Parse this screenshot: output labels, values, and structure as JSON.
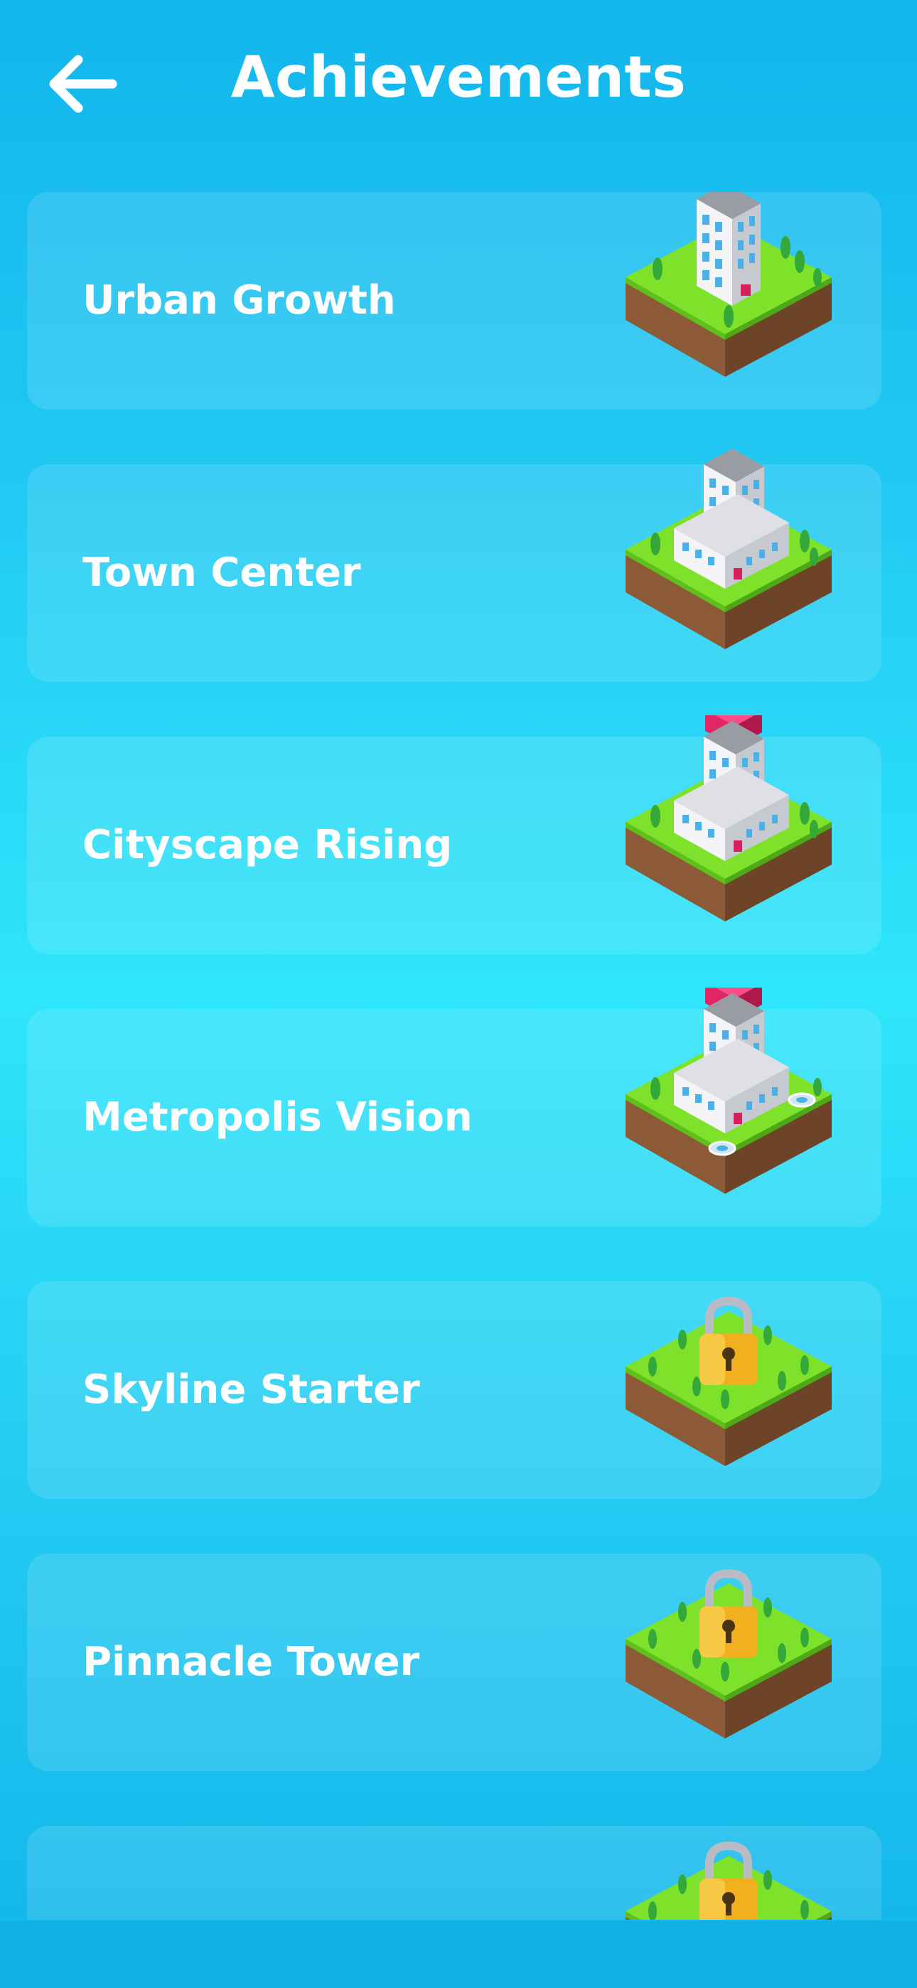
{
  "header": {
    "title": "Achievements",
    "back_icon": "arrow-left-icon"
  },
  "achievements": [
    {
      "label": "Urban Growth",
      "status": "unlocked",
      "icon": "building-tile-icon"
    },
    {
      "label": "Town Center",
      "status": "unlocked",
      "icon": "building-tile-icon"
    },
    {
      "label": "Cityscape Rising",
      "status": "unlocked",
      "icon": "building-tile-icon"
    },
    {
      "label": "Metropolis Vision",
      "status": "unlocked",
      "icon": "building-tile-icon"
    },
    {
      "label": "Skyline Starter",
      "status": "locked",
      "icon": "lock-icon"
    },
    {
      "label": "Pinnacle Tower",
      "status": "locked",
      "icon": "lock-icon"
    },
    {
      "label": "",
      "status": "locked",
      "icon": "lock-icon"
    }
  ],
  "colors": {
    "grass": "#7ee22a",
    "grass_dark": "#5fc01c",
    "soil_left": "#8c5a36",
    "soil_right": "#6e4428",
    "window": "#4ab0e8",
    "roof_red": "#d81f5e",
    "lock_gold": "#f2b01e",
    "tree": "#35a83a"
  }
}
